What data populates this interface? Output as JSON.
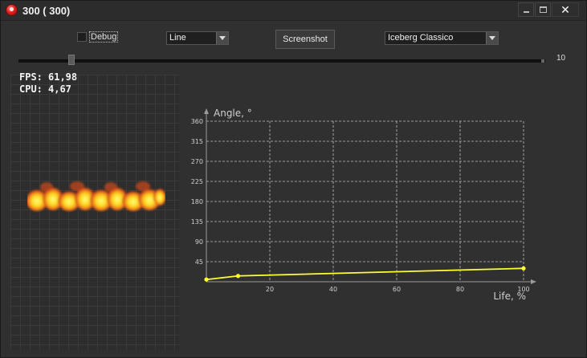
{
  "window": {
    "title": "300 ( 300)",
    "min_label": "_",
    "close_label": "✕"
  },
  "toolbar": {
    "debug_label": "Debug",
    "debug_checked": false,
    "type_select": {
      "value": "Line"
    },
    "screenshot_label": "Screenshot",
    "theme_select": {
      "value": "Iceberg Classico"
    }
  },
  "slider": {
    "value": "10",
    "position_fraction": 0.1
  },
  "stats": {
    "fps_label": "FPS:",
    "fps_value": "61,98",
    "cpu_label": "CPU:",
    "cpu_value": "4,67"
  },
  "chart_data": {
    "type": "line",
    "xlabel": "Life, %",
    "ylabel": "Angle, °",
    "xlim": [
      0,
      100
    ],
    "ylim": [
      0,
      360
    ],
    "x_ticks": [
      20,
      40,
      60,
      80,
      100
    ],
    "y_ticks": [
      45,
      90,
      135,
      180,
      225,
      270,
      315,
      360
    ],
    "grid": true,
    "series": [
      {
        "x": [
          0,
          10,
          100
        ],
        "y": [
          5,
          13,
          30
        ]
      }
    ],
    "colors": {
      "line": "#ffff33",
      "grid": "#bdbdbd",
      "axis": "#9a9a9a",
      "text": "#cfcfcf"
    }
  }
}
